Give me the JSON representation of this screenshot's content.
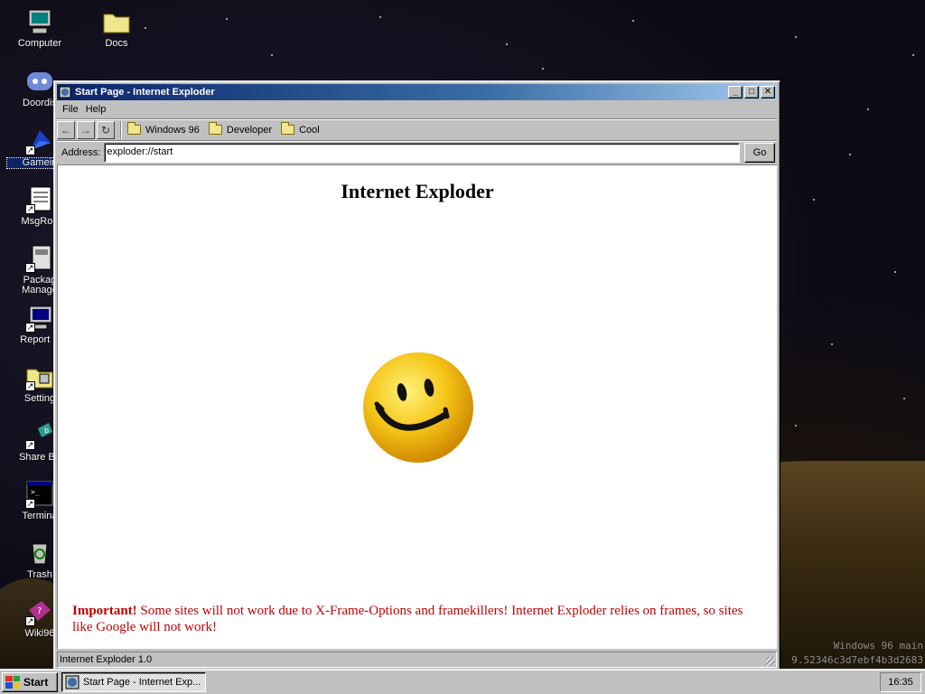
{
  "desktop": {
    "icons": [
      {
        "label": "Computer",
        "icon": "computer-icon"
      },
      {
        "label": "Docs",
        "icon": "folder-icon"
      },
      {
        "label": "Doordis",
        "icon": "discord-icon"
      },
      {
        "label": "Gamein",
        "icon": "game-icon"
      },
      {
        "label": "MsgRoo",
        "icon": "message-room-icon"
      },
      {
        "label": "Packag Manage",
        "icon": "package-manager-icon"
      },
      {
        "label": "Report B",
        "icon": "report-bug-icon"
      },
      {
        "label": "Setting",
        "icon": "settings-icon"
      },
      {
        "label": "Share Bo",
        "icon": "share-icon"
      },
      {
        "label": "Termina",
        "icon": "terminal-icon"
      },
      {
        "label": "Trash",
        "icon": "trash-icon"
      },
      {
        "label": "Wiki96",
        "icon": "wiki-icon"
      }
    ],
    "watermark_line1": "Windows 96 main",
    "watermark_line2": "9.52346c3d7ebf4b3d2683"
  },
  "window": {
    "title": "Start Page - Internet Exploder",
    "menu": [
      "File",
      "Help"
    ],
    "toolbar": {
      "back_glyph": "←",
      "forward_glyph": "→",
      "refresh_glyph": "↻",
      "bookmarks": [
        "Windows 96",
        "Developer",
        "Cool"
      ]
    },
    "address": {
      "label": "Address:",
      "value": "exploder://start",
      "go_label": "Go"
    },
    "page": {
      "heading": "Internet Exploder",
      "notice_bold": "Important!",
      "notice_text": " Some sites will not work due to X-Frame-Options and framekillers! Internet Exploder relies on frames, so sites like Google will not work!"
    },
    "status": "Internet Exploder 1.0"
  },
  "taskbar": {
    "start_label": "Start",
    "task_label": "Start Page - Internet Exp...",
    "clock": "16:35"
  },
  "colors": {
    "title_gradient_start": "#0a246a",
    "title_gradient_end": "#a6caf0",
    "notice_red": "#c00000",
    "smiley_yellow": "#f5c518"
  }
}
